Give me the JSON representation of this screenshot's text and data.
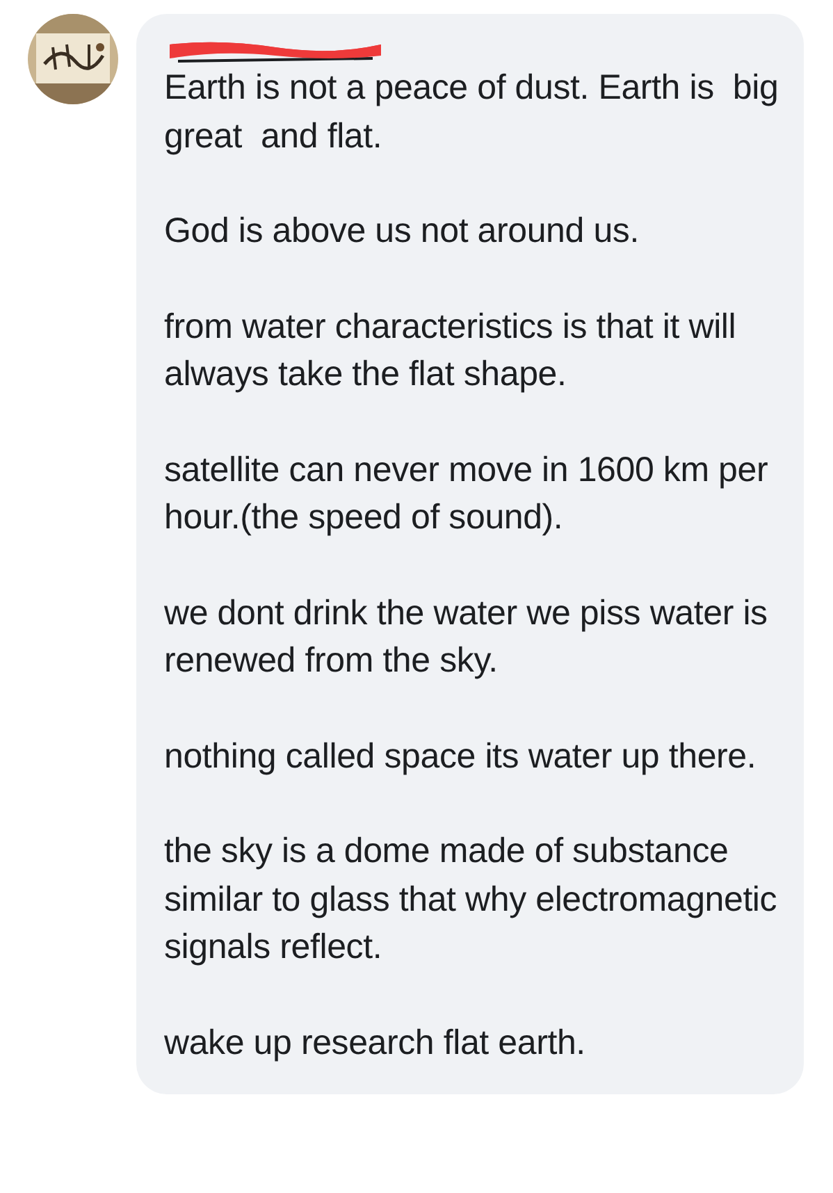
{
  "comment": {
    "paragraphs": [
      "Earth is not a peace of dust. Earth is  big great  and flat.",
      "God is above us not around us.",
      "from water characteristics is that it will always take the flat shape.",
      "satellite can never move in 1600 km per hour.(the speed of sound).",
      "we dont drink the water we piss water is renewed from the sky.",
      "nothing called space its water up there.",
      "the sky is a dome made of substance similar to glass that why electromagnetic signals reflect.",
      "wake up research flat earth."
    ]
  }
}
